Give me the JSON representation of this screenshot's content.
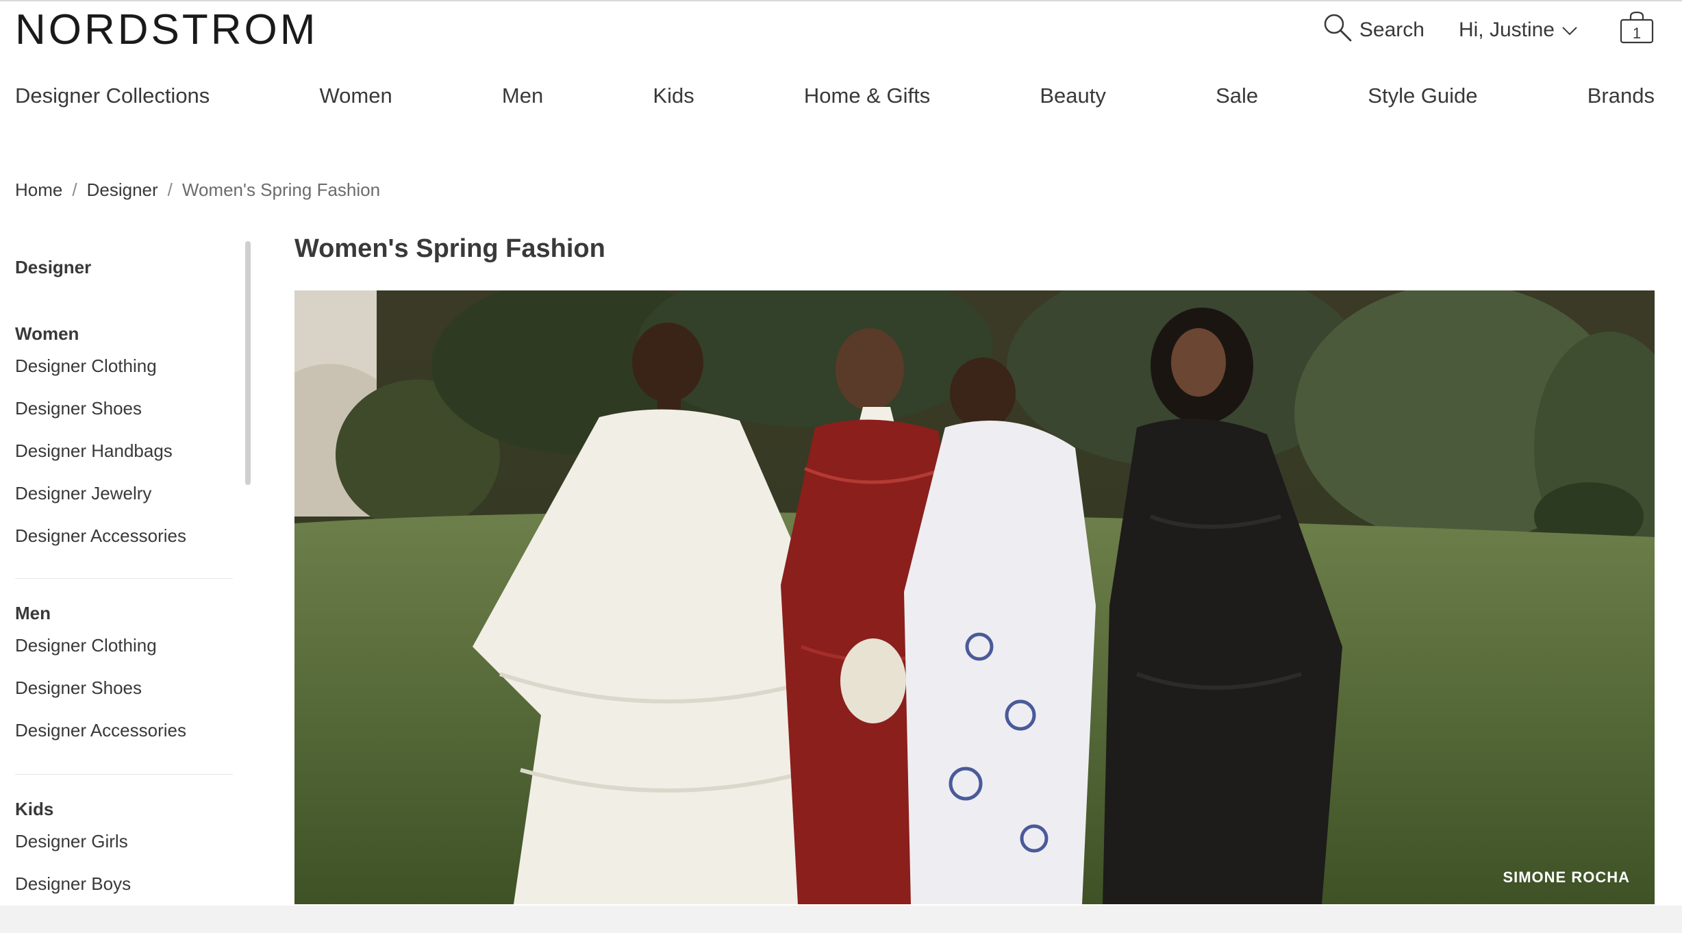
{
  "header": {
    "logo": "NORDSTROM",
    "search_label": "Search",
    "account_label": "Hi, Justine",
    "bag_count": "1"
  },
  "nav": {
    "items": [
      "Designer Collections",
      "Women",
      "Men",
      "Kids",
      "Home & Gifts",
      "Beauty",
      "Sale",
      "Style Guide",
      "Brands"
    ]
  },
  "breadcrumb": {
    "home": "Home",
    "designer": "Designer",
    "current": "Women's Spring Fashion",
    "separator": "/"
  },
  "sidebar": {
    "top": "Designer",
    "women": {
      "heading": "Women",
      "links": [
        "Designer Clothing",
        "Designer Shoes",
        "Designer Handbags",
        "Designer Jewelry",
        "Designer Accessories"
      ]
    },
    "men": {
      "heading": "Men",
      "links": [
        "Designer Clothing",
        "Designer Shoes",
        "Designer Accessories"
      ]
    },
    "kids": {
      "heading": "Kids",
      "links": [
        "Designer Girls",
        "Designer Boys"
      ]
    }
  },
  "main": {
    "title": "Women's Spring Fashion",
    "hero_brand": "SIMONE ROCHA"
  },
  "icons": {
    "search": "search-icon",
    "account_chevron": "chevron-down-icon",
    "bag": "shopping-bag-icon"
  }
}
